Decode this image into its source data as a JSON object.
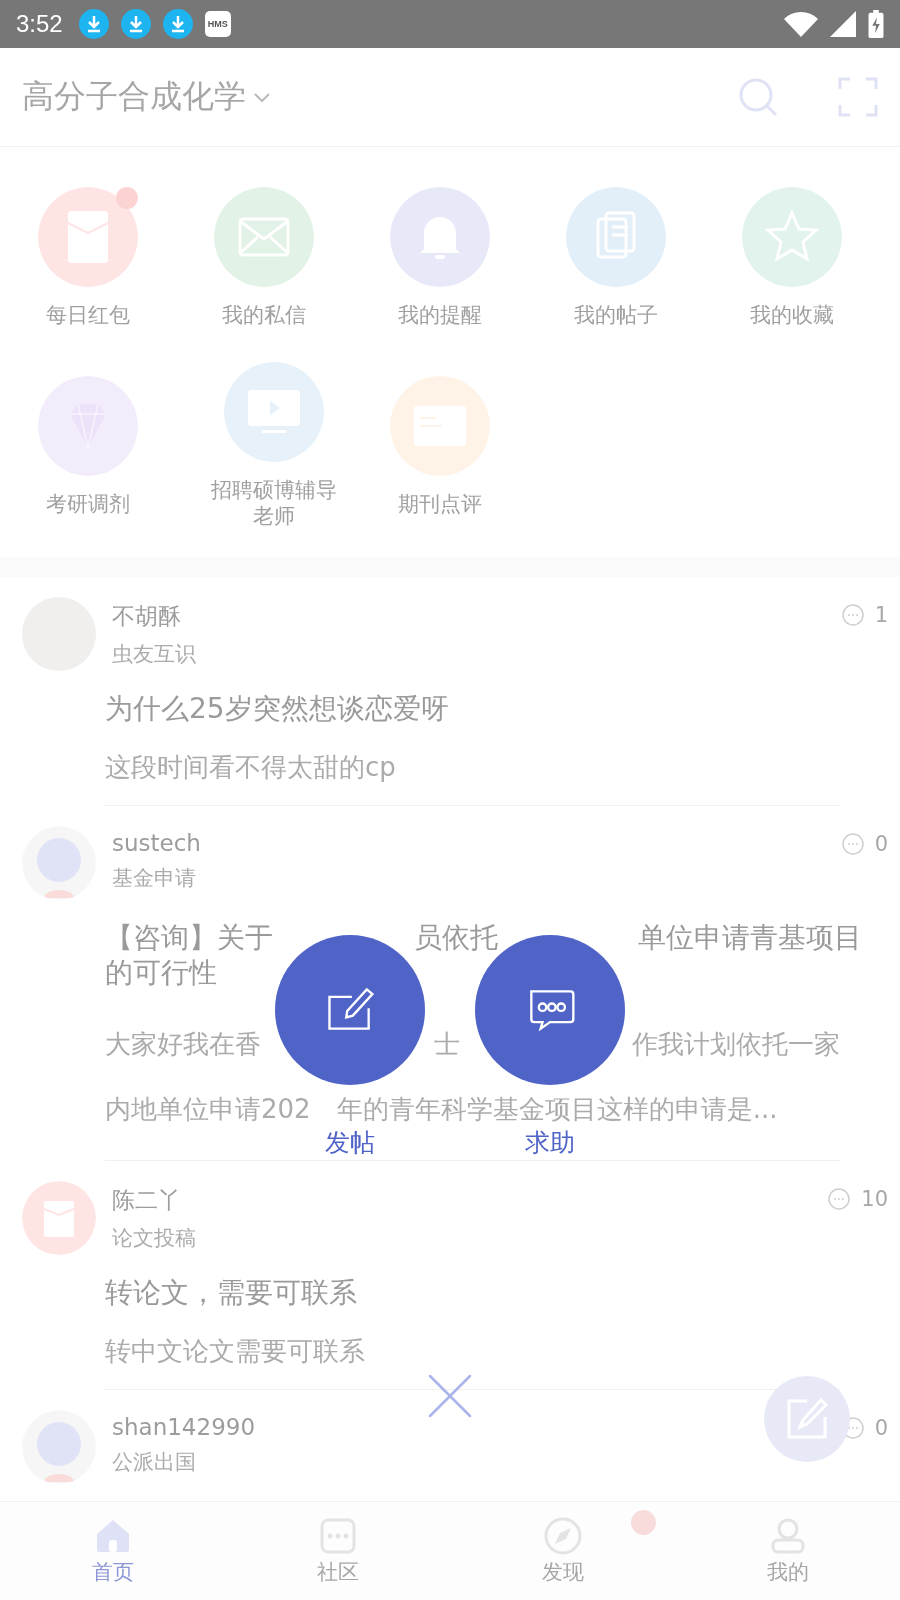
{
  "status_bar": {
    "time": "3:52",
    "hms_badge": "HMS"
  },
  "header": {
    "title": "高分子合成化学"
  },
  "shortcuts": [
    {
      "label": "每日红包",
      "kind": "envelope",
      "color": "#ffe4e4",
      "badge": true
    },
    {
      "label": "我的私信",
      "kind": "mail",
      "color": "#e2f2e6",
      "badge": false
    },
    {
      "label": "我的提醒",
      "kind": "bell",
      "color": "#e7e9f8",
      "badge": false
    },
    {
      "label": "我的帖子",
      "kind": "docs",
      "color": "#e2eff9",
      "badge": false
    },
    {
      "label": "我的收藏",
      "kind": "star",
      "color": "#e2f3ee",
      "badge": false
    },
    {
      "label": "考研调剂",
      "kind": "diamond",
      "color": "#f3edfb",
      "badge": false
    },
    {
      "label": "招聘硕博辅导老师",
      "kind": "screen",
      "color": "#e6f1f9",
      "badge": false
    },
    {
      "label": "期刊点评",
      "kind": "card",
      "color": "#fff3e8",
      "badge": false
    }
  ],
  "posts": [
    {
      "author": "不胡酥",
      "category": "虫友互识",
      "avatar": {
        "kind": "photo"
      },
      "comments": "1",
      "title_lines": [
        [
          "为什么25岁突然想谈恋爱呀"
        ]
      ],
      "excerpt_lines": [
        [
          "这段时间看不得太甜的cp"
        ]
      ]
    },
    {
      "author": "sustech",
      "category": "基金申请",
      "avatar": {
        "kind": "silhouette"
      },
      "comments": "0",
      "title_lines": [
        [
          "【咨询】关于",
          "员依托",
          "单位申请青基项目"
        ],
        [
          "的可行性"
        ]
      ],
      "excerpt_lines": [
        [
          "大家好我在香",
          "士",
          "作我计划依托一家"
        ],
        [
          "内地单位申请202",
          "年的青年科学基金项目这样的申请是..."
        ]
      ]
    },
    {
      "author": "陈二丫",
      "category": "论文投稿",
      "avatar": {
        "kind": "envelope"
      },
      "comments": "10",
      "title_lines": [
        [
          "转论文，需要可联系"
        ]
      ],
      "excerpt_lines": [
        [
          "转中文论文需要可联系"
        ]
      ]
    },
    {
      "author": "shan142990",
      "category": "公派出国",
      "avatar": {
        "kind": "silhouette"
      },
      "comments": "0"
    }
  ],
  "actions": [
    {
      "label": "发帖",
      "kind": "compose"
    },
    {
      "label": "求助",
      "kind": "chat"
    }
  ],
  "bottom_nav": [
    {
      "label": "首页",
      "kind": "home",
      "selected": true,
      "badge": false
    },
    {
      "label": "社区",
      "kind": "community",
      "selected": false,
      "badge": false
    },
    {
      "label": "发现",
      "kind": "compass",
      "selected": false,
      "badge": true
    },
    {
      "label": "我的",
      "kind": "person",
      "selected": false,
      "badge": false
    }
  ]
}
